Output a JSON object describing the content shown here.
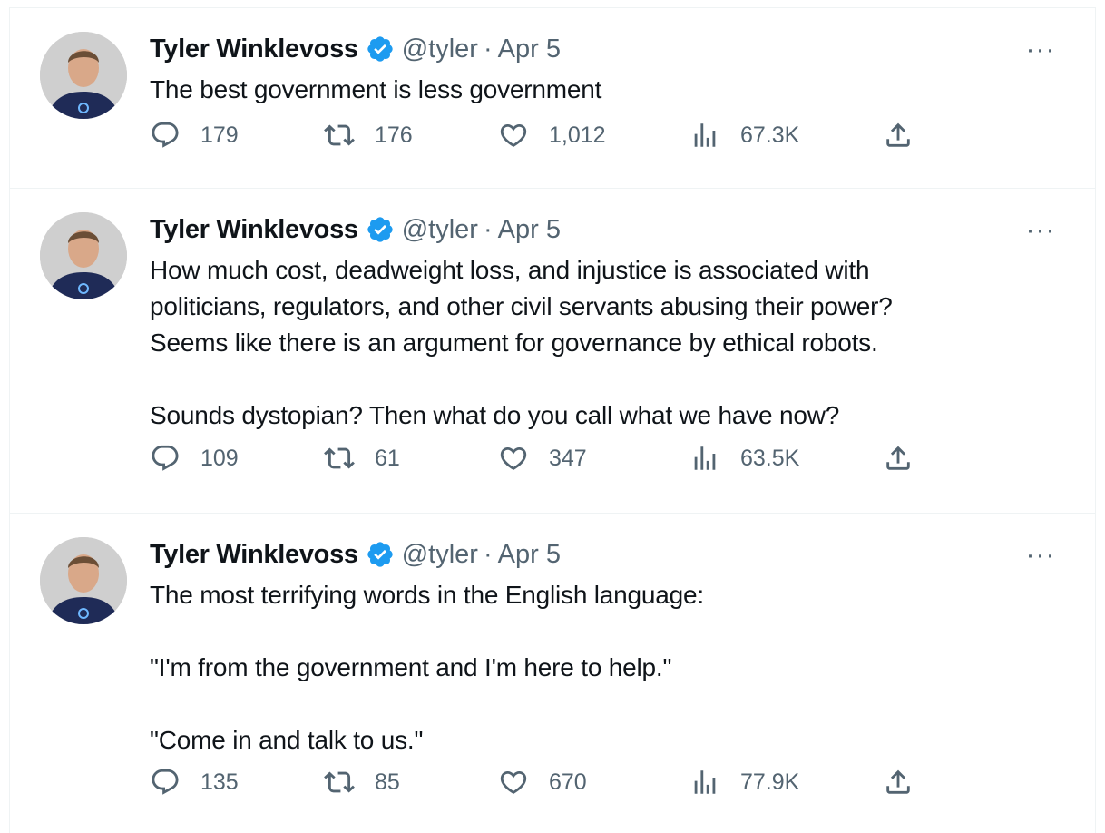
{
  "tweets": [
    {
      "author": {
        "name": "Tyler Winklevoss",
        "handle": "@tyler",
        "separator": "·",
        "date": "Apr 5",
        "verified": true
      },
      "lines": [
        "The best government is less government"
      ],
      "stats": {
        "replies": "179",
        "retweets": "176",
        "likes": "1,012",
        "views": "67.3K"
      }
    },
    {
      "author": {
        "name": "Tyler Winklevoss",
        "handle": "@tyler",
        "separator": "·",
        "date": "Apr 5",
        "verified": true
      },
      "lines": [
        "How much cost, deadweight loss, and injustice is associated with",
        "politicians, regulators, and other civil servants abusing their power?",
        "Seems like there is an argument for governance by ethical robots.",
        "",
        "Sounds dystopian? Then what do you call what we have now?"
      ],
      "stats": {
        "replies": "109",
        "retweets": "61",
        "likes": "347",
        "views": "63.5K"
      }
    },
    {
      "author": {
        "name": "Tyler Winklevoss",
        "handle": "@tyler",
        "separator": "·",
        "date": "Apr 5",
        "verified": true
      },
      "lines": [
        "The most terrifying words in the English language:",
        "",
        "\"I'm from the government and I'm here to help.\"",
        "",
        "\"Come in and talk to us.\""
      ],
      "stats": {
        "replies": "135",
        "retweets": "85",
        "likes": "670",
        "views": "77.9K"
      }
    }
  ],
  "icons": {
    "reply": "reply-icon",
    "retweet": "retweet-icon",
    "like": "heart-icon",
    "views": "views-icon",
    "share": "share-icon",
    "more": "more-icon",
    "verified": "verified-badge-icon"
  },
  "more_glyph": "···",
  "colors": {
    "text": "#0f1419",
    "muted": "#536471",
    "verified": "#1d9bf0",
    "divider": "#eff3f4"
  }
}
